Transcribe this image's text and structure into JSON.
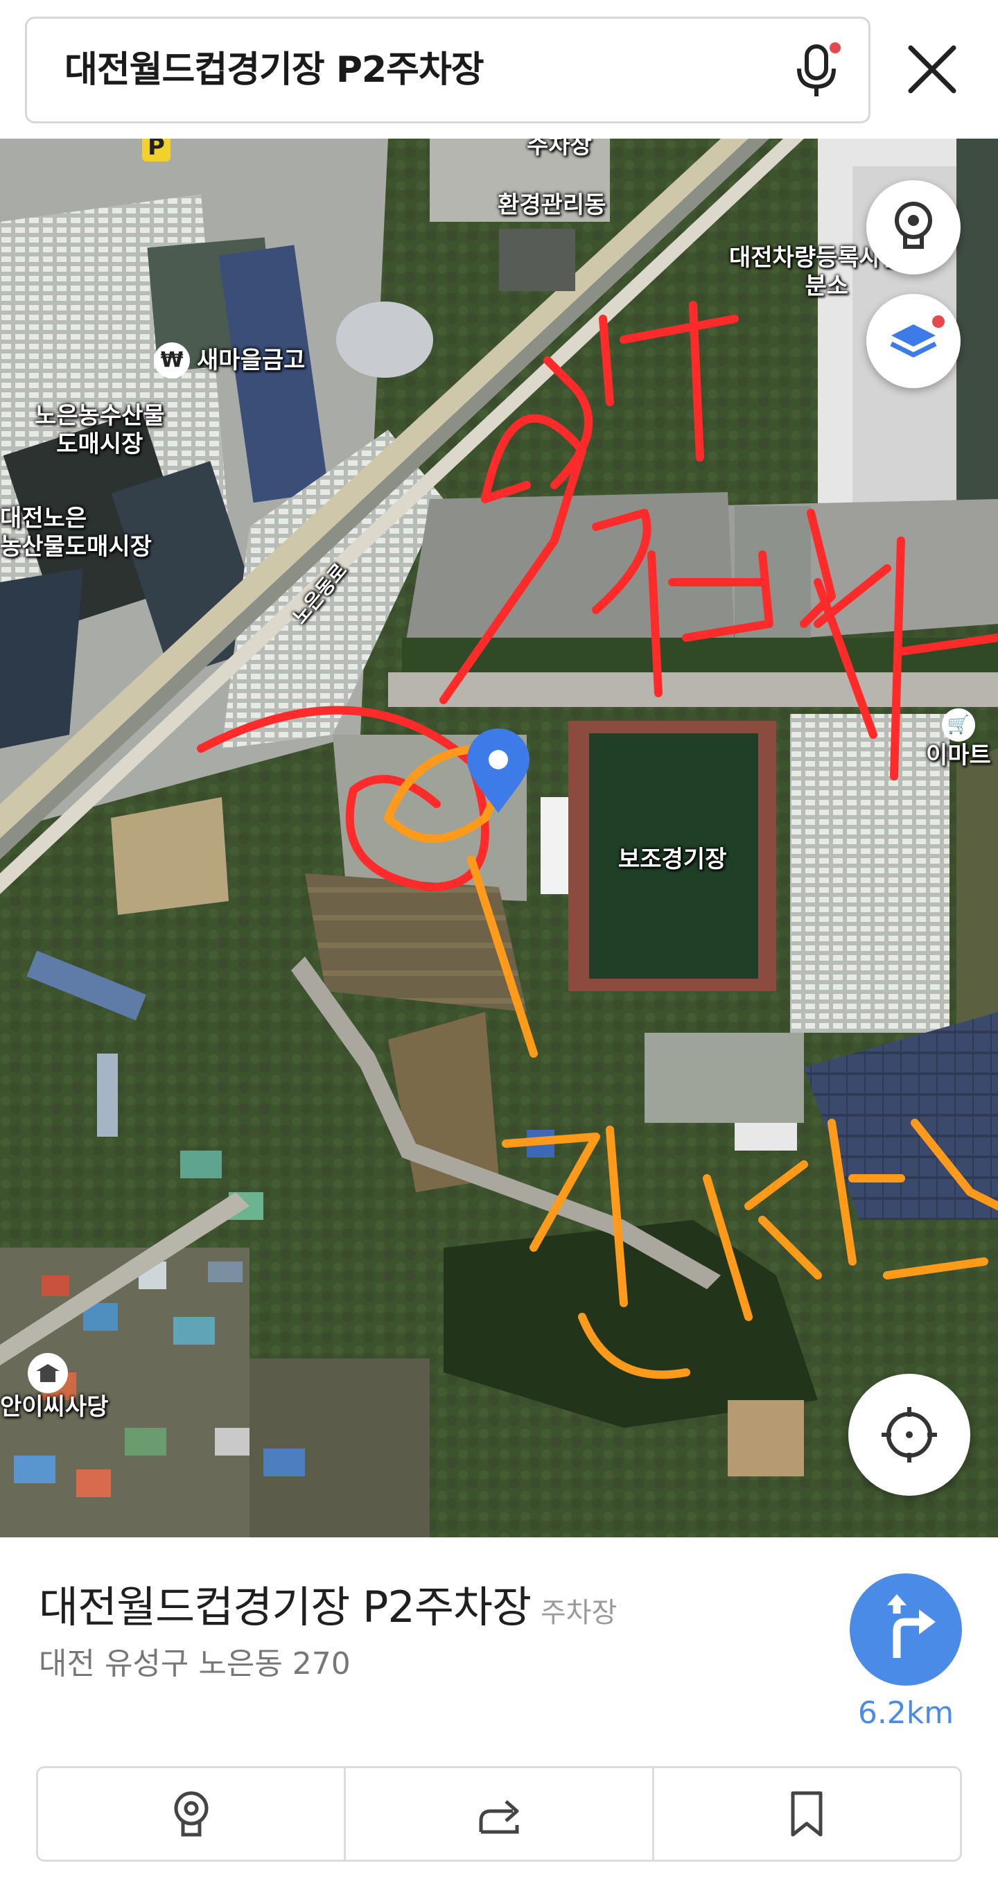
{
  "search": {
    "query": "대전월드컵경기장 P2주차장"
  },
  "icons": {
    "mic": "mic-icon",
    "close": "close-icon",
    "roadview": "roadview-icon",
    "layers": "layers-icon",
    "locate": "current-location-icon",
    "marker": "location-pin-icon",
    "route": "route-arrow-icon",
    "share": "share-icon",
    "bookmark": "bookmark-icon"
  },
  "map": {
    "labels": {
      "parking": "P",
      "parking_lot_top": "주차장",
      "env_building": "환경관리동",
      "vehicle_office": "대전차량등록사업소\n분소",
      "bank": "새마을금고",
      "market1": "노은농수산물\n도매시장",
      "market2": "대전노은\n농산물도매시장",
      "road": "노은동로",
      "emart": "이마트",
      "sub_stadium": "보조경기장",
      "shrine": "안이씨사당"
    },
    "annotations": {
      "red_text": "DT 검사",
      "orange_text": "검사소"
    }
  },
  "place": {
    "name": "대전월드컵경기장 P2주차장",
    "category": "주차장",
    "address": "대전 유성구 노은동 270",
    "distance": "6.2km"
  },
  "colors": {
    "accent_blue": "#4a8be8",
    "annotation_red": "#ff2a2a",
    "annotation_orange": "#ff9a1a",
    "notification_dot": "#e5484d"
  }
}
